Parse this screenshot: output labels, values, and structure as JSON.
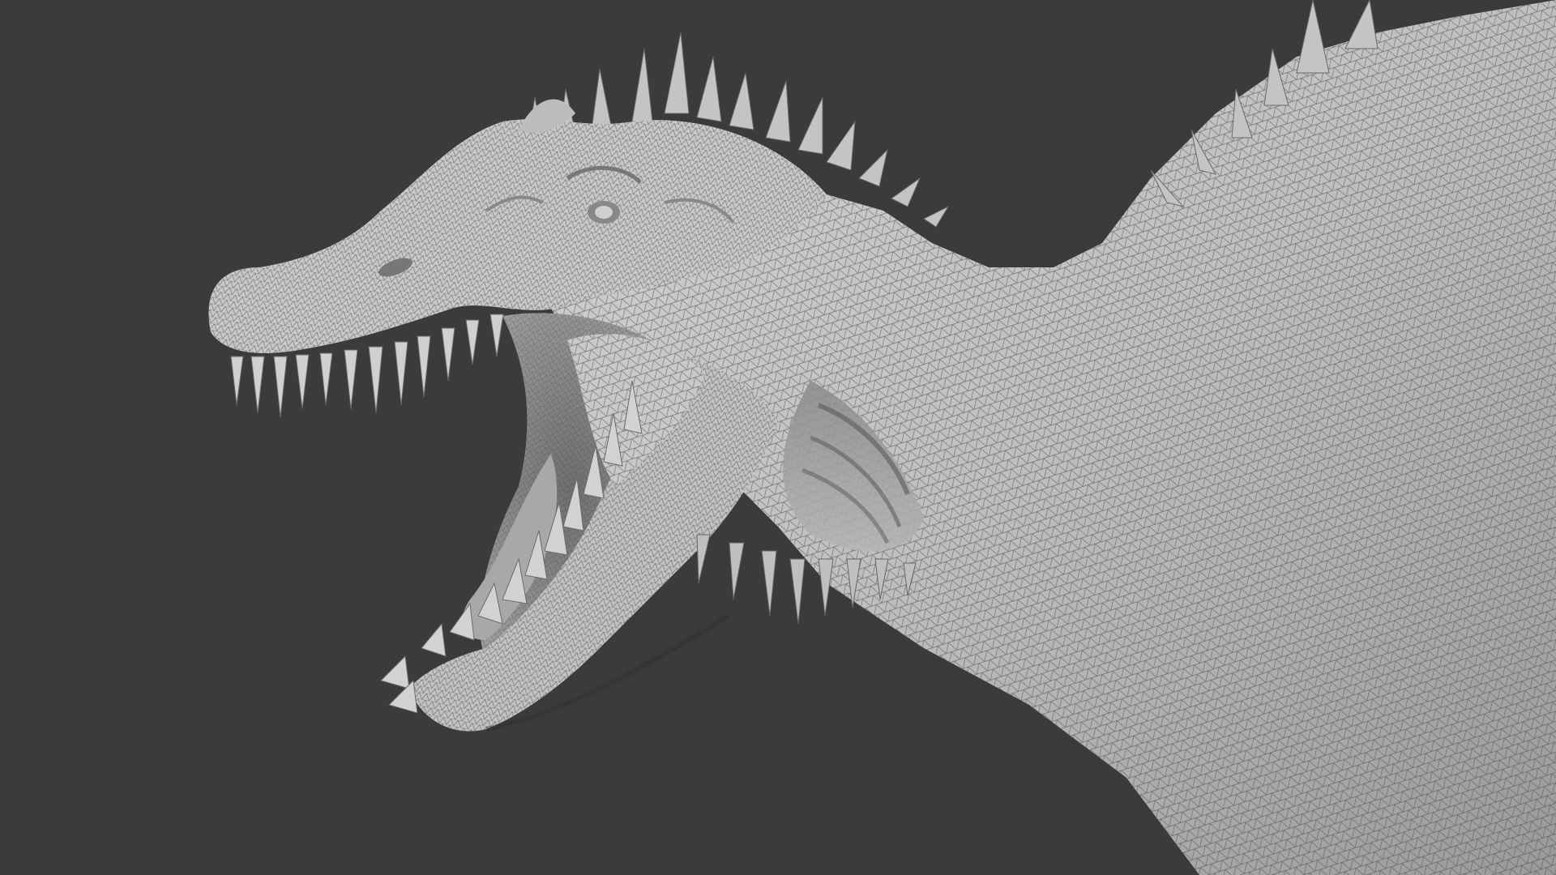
{
  "scene": {
    "background_color": "#3b3b3b",
    "subject": "spinosaurus-head-sculpt",
    "render_style": "wireframe-on-shaded",
    "mesh_color": "#bdbdbd",
    "wire_color": "#4a4a4a",
    "shadow_color": "#2a2a2a"
  }
}
